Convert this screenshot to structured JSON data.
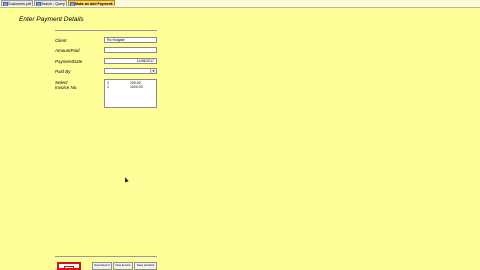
{
  "tabs": [
    {
      "label": "Customers.pdf",
      "active": false
    },
    {
      "label": "Search - Query",
      "active": false
    },
    {
      "label": "Make an Add Payment",
      "active": true
    }
  ],
  "form": {
    "title": "Enter Payment Details",
    "labels": {
      "client": "Client",
      "amount_paid": "AmountPaid",
      "payment_date": "PaymentDate",
      "paid_by": "Paid By",
      "select_invoice": "Select\nInvoice No."
    },
    "values": {
      "client": "Ro Holgate",
      "amount_paid": "",
      "payment_date": "11/08/2017",
      "paid_by": ""
    },
    "invoices": [
      {
        "no": "2",
        "amount": "200.00"
      },
      {
        "no": "1",
        "amount": "1020.00"
      }
    ]
  },
  "buttons": {
    "save": "",
    "new_record": "New Record",
    "new_invoice": "New Invoice",
    "save_exit": "Save and Exit"
  },
  "colors": {
    "background": "#ffff99",
    "accent": "#d21414"
  }
}
